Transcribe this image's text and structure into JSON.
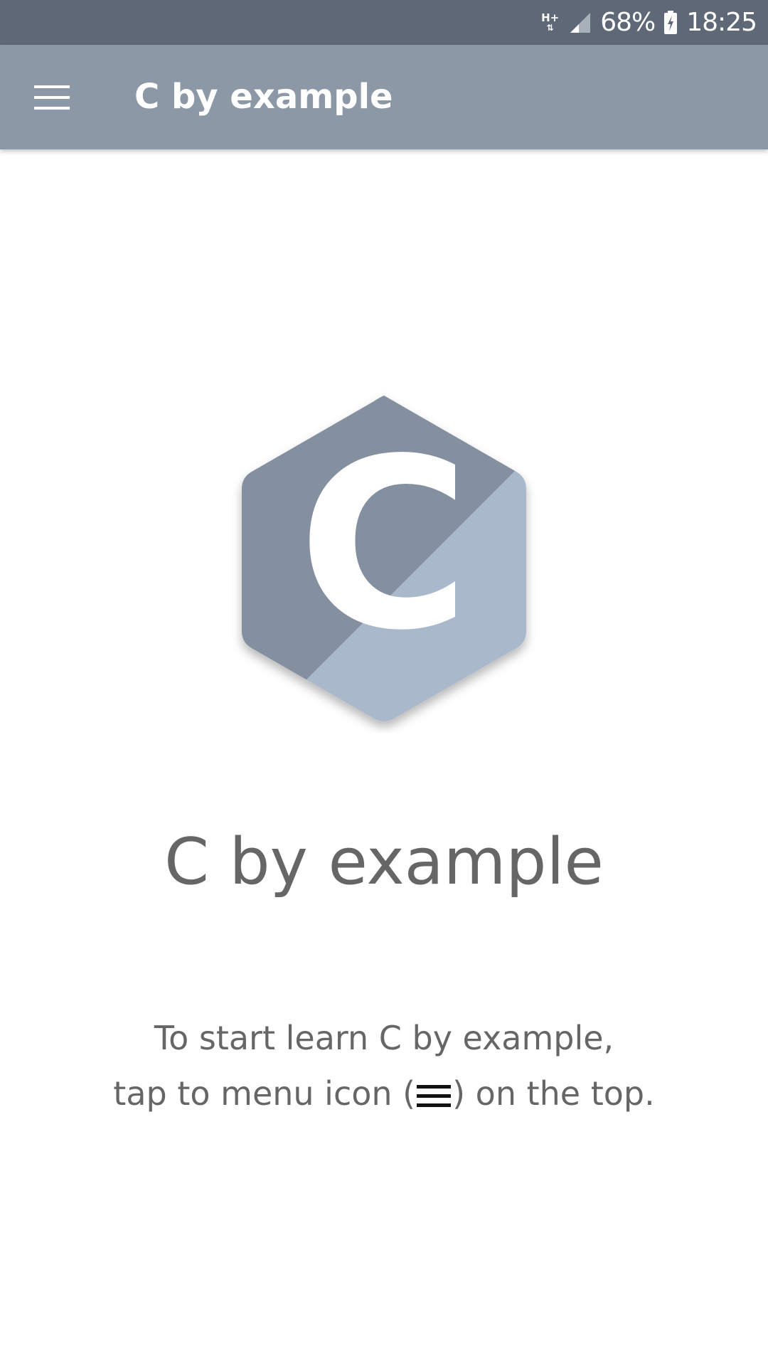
{
  "status_bar": {
    "network_type": "H+",
    "network_arrows": "⇅",
    "battery_percent": "68%",
    "time": "18:25"
  },
  "app_bar": {
    "title": "C by example",
    "menu_icon": "hamburger-menu-icon"
  },
  "main": {
    "logo_letter": "C",
    "hero_title": "C by example",
    "hint_line1": "To start learn C by example,",
    "hint_line2_prefix": "tap to menu icon (",
    "hint_line2_suffix": ") on the top."
  },
  "colors": {
    "status_bar_bg": "#5e6876",
    "app_bar_bg": "#8d98a6",
    "logo_dark": "#84909f",
    "logo_light": "#a9b8cb",
    "text_gray": "#666666"
  }
}
